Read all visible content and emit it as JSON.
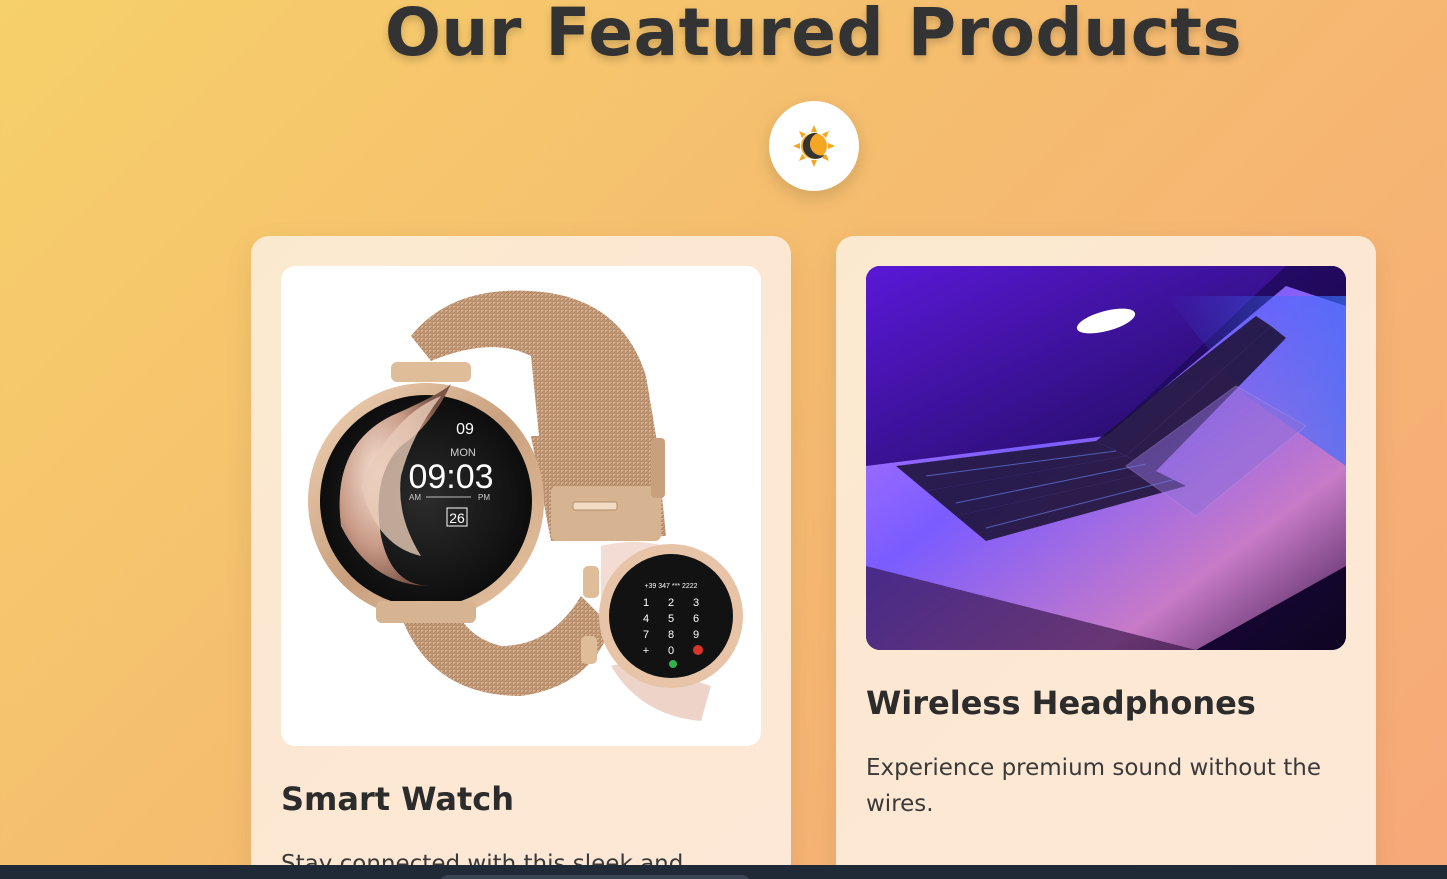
{
  "header": {
    "title": "Our Featured Products"
  },
  "theme_toggle": {
    "icon": "sun-moon-icon",
    "sun_color": "#f5a623",
    "moon_color": "#333333"
  },
  "products": [
    {
      "title": "Smart Watch",
      "description": "Stay connected with this sleek and stylish",
      "image_icon": "smartwatch-image",
      "watch_time": "09:03",
      "watch_day": "MON",
      "watch_date": "26",
      "watch_hour_top": "09",
      "watch_am": "AM",
      "watch_pm": "PM",
      "dial_number": "+39 347 *** 2222"
    },
    {
      "title": "Wireless Headphones",
      "description": "Experience premium sound without the wires.",
      "image_icon": "laptop-image"
    }
  ]
}
